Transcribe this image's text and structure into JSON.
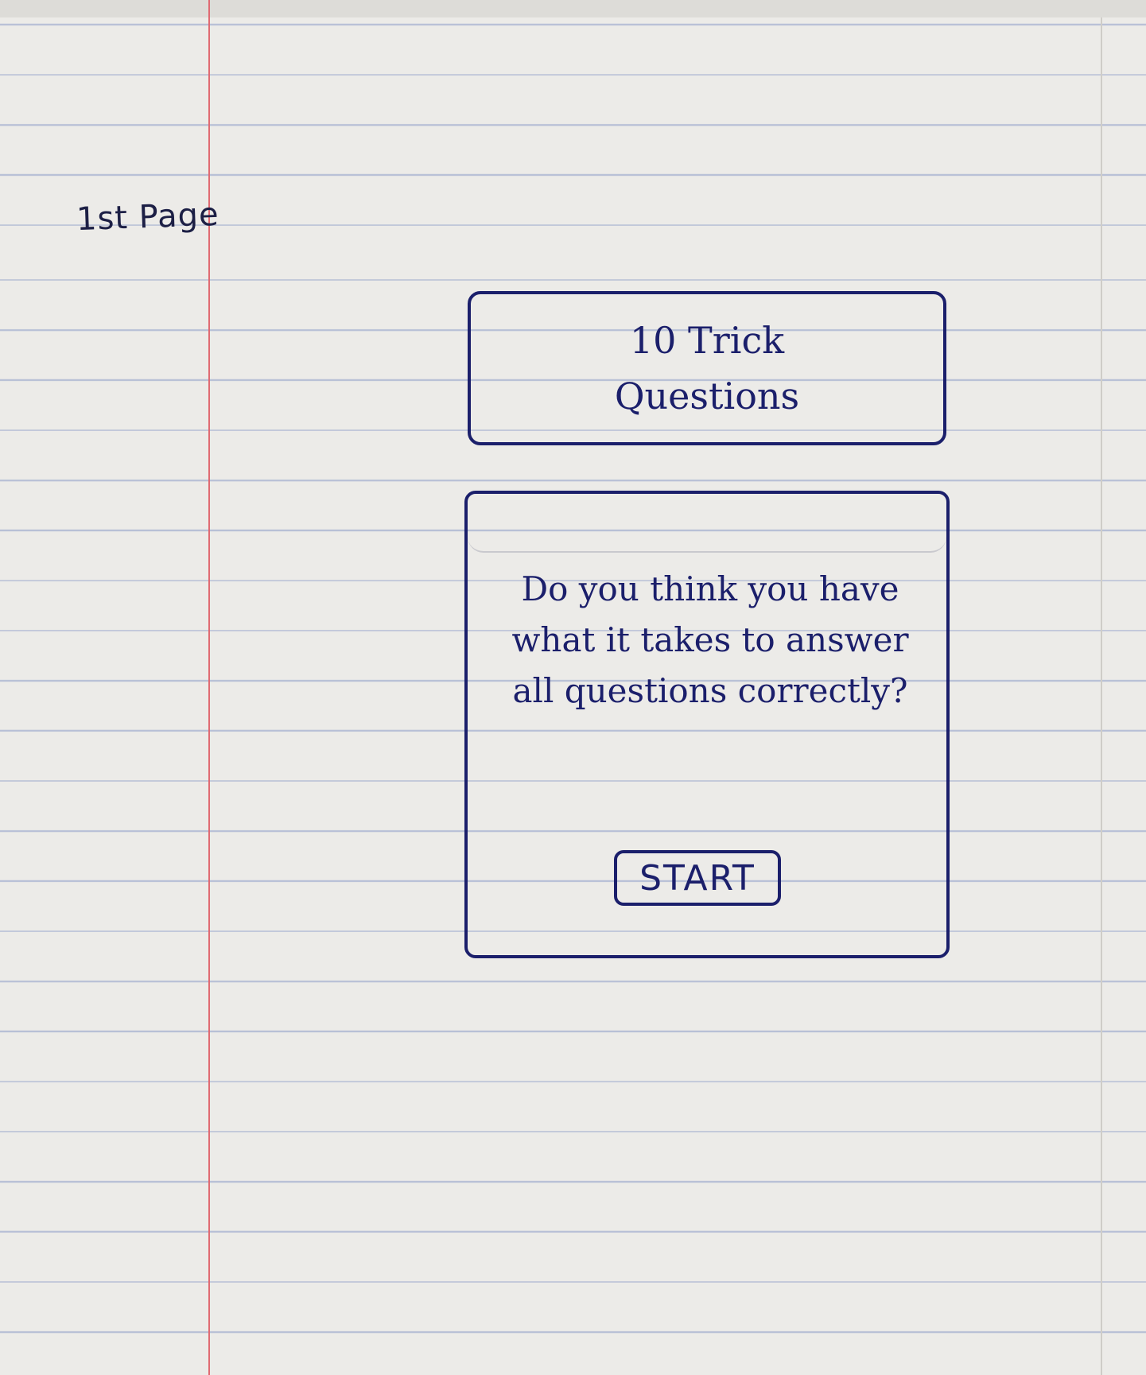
{
  "page_label": "1st Page",
  "title_card": {
    "line1": "10 Trick",
    "line2": "Questions"
  },
  "intro_card": {
    "prompt": "Do you think you have what it takes to answer all questions correctly?",
    "start_label": "START"
  },
  "colors": {
    "ink": "#1b1f6b",
    "paper": "#ecebe8",
    "rule_line": "#b8c0d6",
    "margin_line": "#e06a72"
  }
}
